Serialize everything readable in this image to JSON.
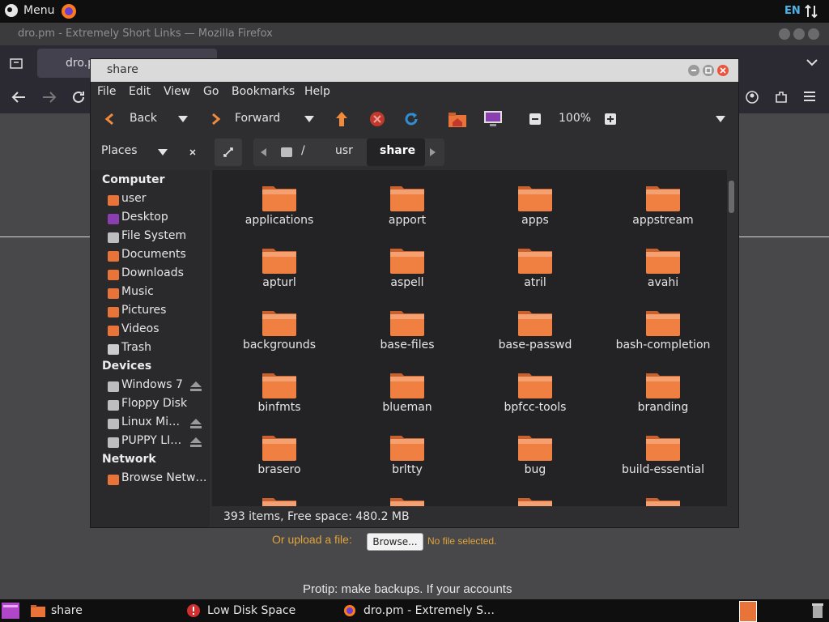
{
  "top_panel": {
    "menu_label": "Menu",
    "lang": "EN"
  },
  "firefox": {
    "window_title": "dro.pm - Extremely Short Links — Mozilla Firefox",
    "tab_label": "dro.p",
    "upload_label": "Or upload a file:",
    "browse_label": "Browse...",
    "no_file": "No file selected.",
    "protip": "Protip: make backups. If your accounts"
  },
  "file_manager": {
    "title": "share",
    "menu": [
      "File",
      "Edit",
      "View",
      "Go",
      "Bookmarks",
      "Help"
    ],
    "toolbar": {
      "back": "Back",
      "forward": "Forward",
      "zoom": "100%"
    },
    "places_label": "Places",
    "path": [
      "/",
      "usr",
      "share"
    ],
    "sidebar": {
      "computer_header": "Computer",
      "computer_items": [
        "user",
        "Desktop",
        "File System",
        "Documents",
        "Downloads",
        "Music",
        "Pictures",
        "Videos",
        "Trash"
      ],
      "devices_header": "Devices",
      "devices_items": [
        "Windows 7",
        "Floppy Disk",
        "Linux Mi…",
        "PUPPY LI…"
      ],
      "network_header": "Network",
      "network_items": [
        "Browse Netw…"
      ]
    },
    "files": [
      "applications",
      "apport",
      "apps",
      "appstream",
      "apturl",
      "aspell",
      "atril",
      "avahi",
      "backgrounds",
      "base-files",
      "base-passwd",
      "bash-completion",
      "binfmts",
      "blueman",
      "bpfcc-tools",
      "branding",
      "brasero",
      "brltty",
      "bug",
      "build-essential"
    ],
    "status": "393 items, Free space: 480.2 MB"
  },
  "taskbar": {
    "items": [
      "share",
      "Low Disk Space",
      "dro.pm - Extremely S…"
    ]
  },
  "colors": {
    "folder": "#e9743a",
    "accent_orange": "#e0a43c",
    "lang": "#4fb3e8"
  }
}
